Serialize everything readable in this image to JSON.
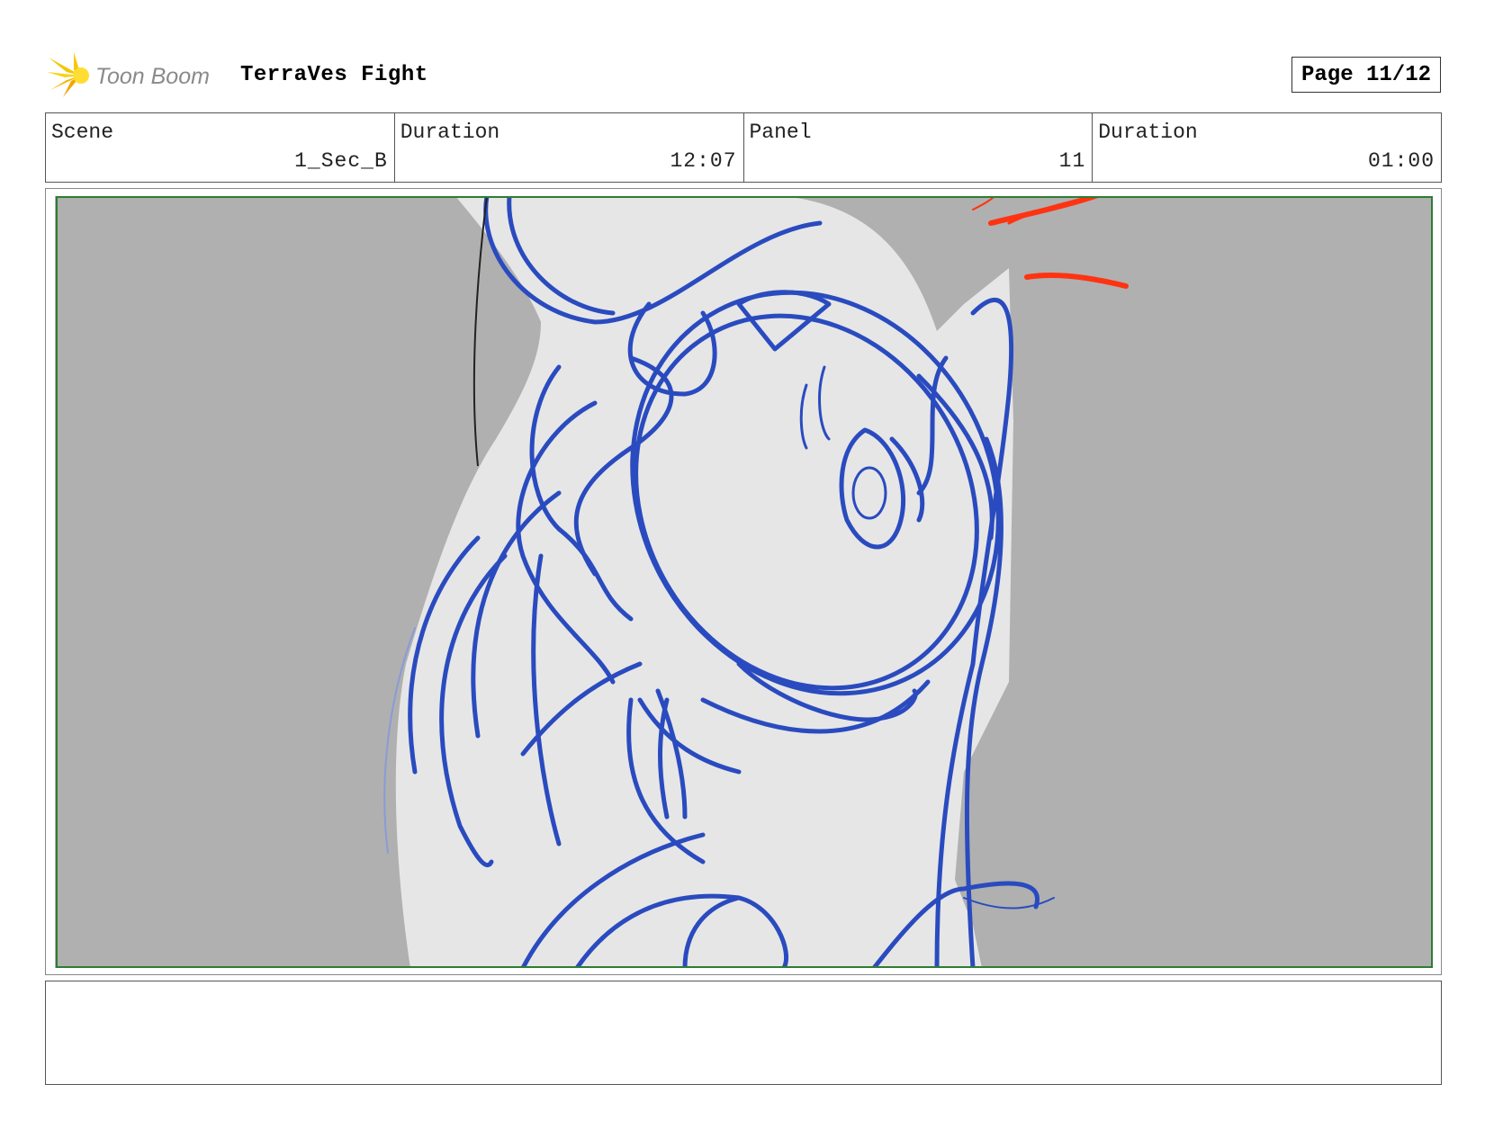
{
  "header": {
    "logo_text": "Toon Boom",
    "project_title": "TerraVes Fight",
    "page_label": "Page 11/12"
  },
  "info": {
    "scene_label": "Scene",
    "scene_value": "1_Sec_B",
    "scene_duration_label": "Duration",
    "scene_duration_value": "12:07",
    "panel_label": "Panel",
    "panel_value": "11",
    "panel_duration_label": "Duration",
    "panel_duration_value": "01:00"
  },
  "panel": {
    "background_color": "#b0b0b0",
    "safe_frame_color": "#2e7d32",
    "sketch_color": "#2a4bbf",
    "accent_stroke_color": "#ff3311"
  },
  "notes": {
    "text": ""
  }
}
